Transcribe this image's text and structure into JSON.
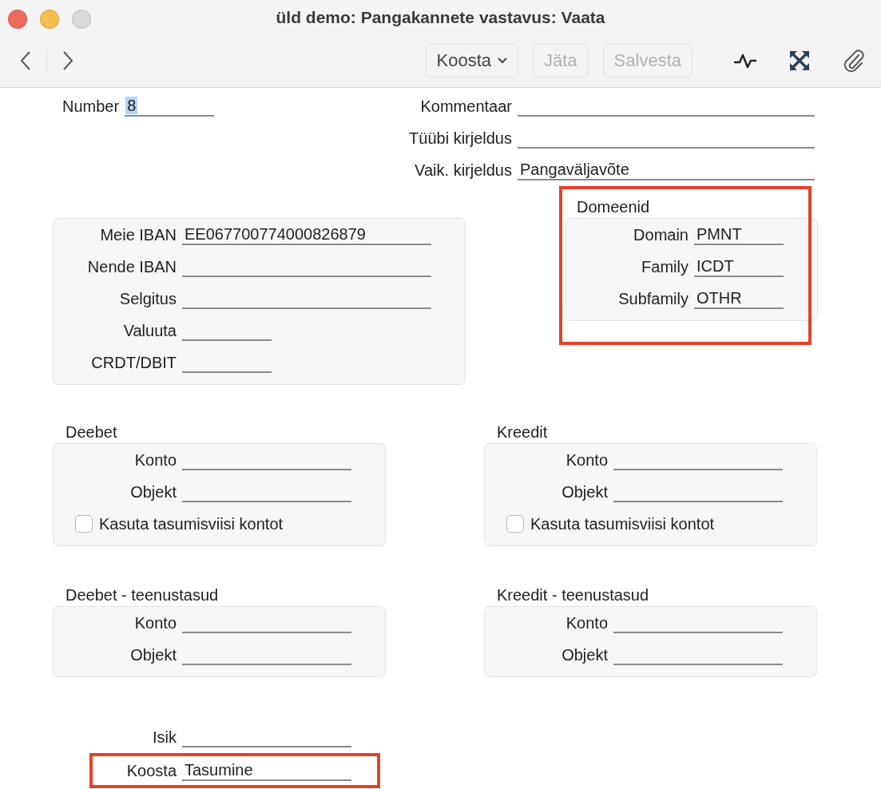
{
  "window": {
    "title": "üld demo: Pangakannete vastavus: Vaata"
  },
  "toolbar": {
    "buttons": [
      {
        "label": "Koosta",
        "kind": "menu",
        "disabled": false
      },
      {
        "label": "Jäta",
        "kind": "plain",
        "disabled": true
      },
      {
        "label": "Salvesta",
        "kind": "plain",
        "disabled": true
      }
    ]
  },
  "header": {
    "number": {
      "label": "Number",
      "value": "8",
      "selected": true,
      "kind": "narrow"
    },
    "fields": [
      {
        "label": "Kommentaar",
        "kind": "full"
      },
      {
        "label": "Tüübi kirjeldus",
        "kind": "full"
      },
      {
        "label": "Vaik. kirjeldus",
        "value": "Pangaväljavõte",
        "kind": "full"
      }
    ]
  },
  "account_panel": {
    "fields": [
      {
        "label": "Meie IBAN",
        "value": "EE067700774000826879",
        "kind": "wide"
      },
      {
        "label": "Nende IBAN",
        "kind": "wide"
      },
      {
        "label": "Selgitus",
        "kind": "wide"
      },
      {
        "label": "Valuuta",
        "kind": "narrow"
      },
      {
        "label": "CRDT/DBIT",
        "kind": "narrow"
      }
    ]
  },
  "domains": {
    "title": "Domeenid",
    "highlighted": true,
    "fields": [
      {
        "label": "Domain",
        "value": "PMNT",
        "kind": "narrow"
      },
      {
        "label": "Family",
        "value": "ICDT",
        "kind": "narrow"
      },
      {
        "label": "Subfamily",
        "value": "OTHR",
        "kind": "narrow"
      }
    ]
  },
  "sections": [
    {
      "title": "Deebet",
      "fields": [
        {
          "label": "Konto",
          "kind": "medium"
        },
        {
          "label": "Objekt",
          "kind": "medium"
        }
      ],
      "checkbox": {
        "label": "Kasuta tasumisviisi kontot",
        "checked": false
      }
    },
    {
      "title": "Kreedit",
      "fields": [
        {
          "label": "Konto",
          "kind": "medium"
        },
        {
          "label": "Objekt",
          "kind": "medium"
        }
      ],
      "checkbox": {
        "label": "Kasuta tasumisviisi kontot",
        "checked": false
      }
    },
    {
      "title": "Deebet - teenustasud",
      "fields": [
        {
          "label": "Konto",
          "kind": "medium"
        },
        {
          "label": "Objekt",
          "kind": "medium"
        }
      ]
    },
    {
      "title": "Kreedit - teenustasud",
      "fields": [
        {
          "label": "Konto",
          "kind": "medium"
        },
        {
          "label": "Objekt",
          "kind": "medium"
        }
      ]
    }
  ],
  "footer_fields": [
    {
      "label": "Isik",
      "kind": "medium",
      "highlighted": false
    },
    {
      "label": "Koosta",
      "value": "Tasumine",
      "kind": "medium",
      "highlighted": true
    }
  ]
}
